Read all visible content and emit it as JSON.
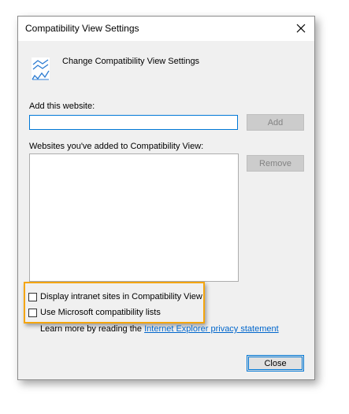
{
  "window": {
    "title": "Compatibility View Settings"
  },
  "header": {
    "text": "Change Compatibility View Settings"
  },
  "add_section": {
    "label": "Add this website:",
    "input_value": "",
    "add_button": "Add"
  },
  "list_section": {
    "label": "Websites you've added to Compatibility View:",
    "items": [],
    "remove_button": "Remove"
  },
  "options": {
    "intranet": {
      "label": "Display intranet sites in Compatibility View",
      "checked": false
    },
    "microsoft_lists": {
      "label": "Use Microsoft compatibility lists",
      "checked": false
    }
  },
  "learn_more": {
    "prefix": "Learn more by reading the ",
    "link": "Internet Explorer privacy statement"
  },
  "footer": {
    "close_button": "Close"
  },
  "colors": {
    "dialog_bg": "#f0f0f0",
    "accent": "#0078d7",
    "highlight": "#f4a50d",
    "link": "#0066cc"
  },
  "icons": {
    "close": "close-icon",
    "header": "compatibility-view-icon"
  }
}
